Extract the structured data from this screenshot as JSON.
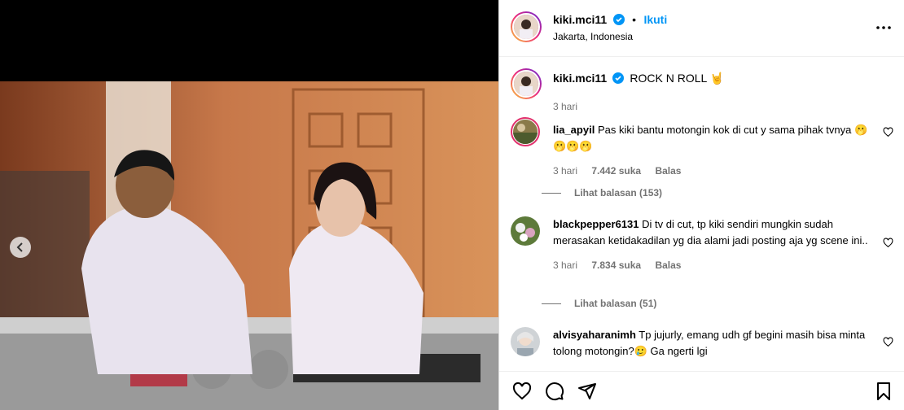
{
  "post": {
    "username": "kiki.mci11",
    "follow_label": "Ikuti",
    "location": "Jakarta, Indonesia"
  },
  "caption": {
    "username": "kiki.mci11",
    "text": "ROCK N ROLL 🤘",
    "time": "3 hari"
  },
  "comments": [
    {
      "username": "lia_apyil",
      "text": "Pas kiki bantu motongin kok di cut y sama pihak tvnya 🫢🫢🫢🫢",
      "time": "3 hari",
      "likes": "7.442 suka",
      "reply_label": "Balas",
      "view_replies": "Lihat balasan (153)"
    },
    {
      "username": "blackpepper6131",
      "text": "Di tv di cut, tp kiki sendiri mungkin sudah merasakan ketidakadilan yg dia alami jadi posting aja yg scene ini..",
      "time": "3 hari",
      "likes": "7.834 suka",
      "reply_label": "Balas",
      "view_replies": "Lihat balasan (51)"
    },
    {
      "username": "alvisyaharanimh",
      "text": "Tp jujurly, emang udh gf begini masih bisa minta tolong motongin?🥲 Ga ngerti lgi"
    }
  ],
  "icons": {
    "like": "heart-icon",
    "comment": "comment-icon",
    "share": "share-icon",
    "save": "bookmark-icon",
    "more": "more-options-icon",
    "prev": "chevron-left-icon",
    "verified": "verified-badge-icon"
  },
  "colors": {
    "link": "#0095f6",
    "verified": "#0095f6",
    "muted": "#737373"
  }
}
